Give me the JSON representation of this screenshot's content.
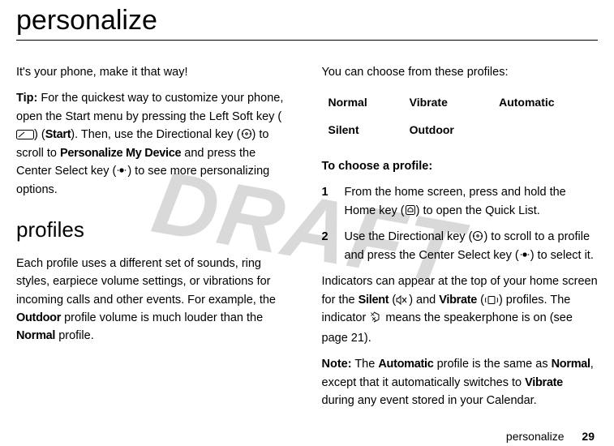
{
  "watermark": "DRAFT",
  "page_title": "personalize",
  "left": {
    "intro": "It's your phone, make it that way!",
    "tip_label": "Tip:",
    "tip_1": " For the quickest way to customize your phone, open the Start menu by pressing the Left Soft key (",
    "tip_start": "Start",
    "tip_2": "). Then, use the Directional key (",
    "tip_3": ") to scroll to ",
    "tip_personalize": "Personalize My Device",
    "tip_4": " and press the Center Select key (",
    "tip_5": ") to see more personalizing options.",
    "profiles_heading": "profiles",
    "profiles_1a": "Each profile uses a different set of sounds, ring styles, earpiece volume settings, or vibrations for incoming calls and other events. For example, the ",
    "profiles_outdoor": "Outdoor",
    "profiles_1b": " profile volume is much louder than the ",
    "profiles_normal": "Normal",
    "profiles_1c": " profile."
  },
  "right": {
    "choose_intro": "You can choose from these profiles:",
    "profiles": [
      [
        "Normal",
        "Vibrate",
        "Automatic"
      ],
      [
        "Silent",
        "Outdoor",
        ""
      ]
    ],
    "to_choose": "To choose a profile:",
    "step1_num": "1",
    "step1_a": "From the home screen, press and hold the Home key (",
    "step1_b": ") to open the Quick List.",
    "step2_num": "2",
    "step2_a": "Use the Directional key (",
    "step2_b": ") to scroll to a profile and press the Center Select key (",
    "step2_c": ") to select it.",
    "indicators_a": "Indicators can appear at the top of your home screen for the ",
    "silent": "Silent",
    "indicators_b": " (",
    "indicators_c": ") and ",
    "vibrate": "Vibrate",
    "indicators_d": " (",
    "indicators_e": ") profiles. The indicator ",
    "indicators_f": " means the speakerphone is on (see page 21).",
    "note_label": "Note:",
    "note_a": " The ",
    "automatic": "Automatic",
    "note_b": " profile is the same as ",
    "normal": "Normal",
    "note_c": ", except that it automatically switches to ",
    "vibrate2": "Vibrate",
    "note_d": " during any event stored in your Calendar."
  },
  "footer": {
    "section": "personalize",
    "page": "29"
  },
  "icons": {
    "softkey": "soft-key-icon",
    "dirkey": "directional-key-icon",
    "centerkey": "center-select-icon",
    "home": "home-key-icon",
    "silent": "silent-indicator-icon",
    "vibrate": "vibrate-indicator-icon",
    "speaker": "speaker-icon"
  }
}
